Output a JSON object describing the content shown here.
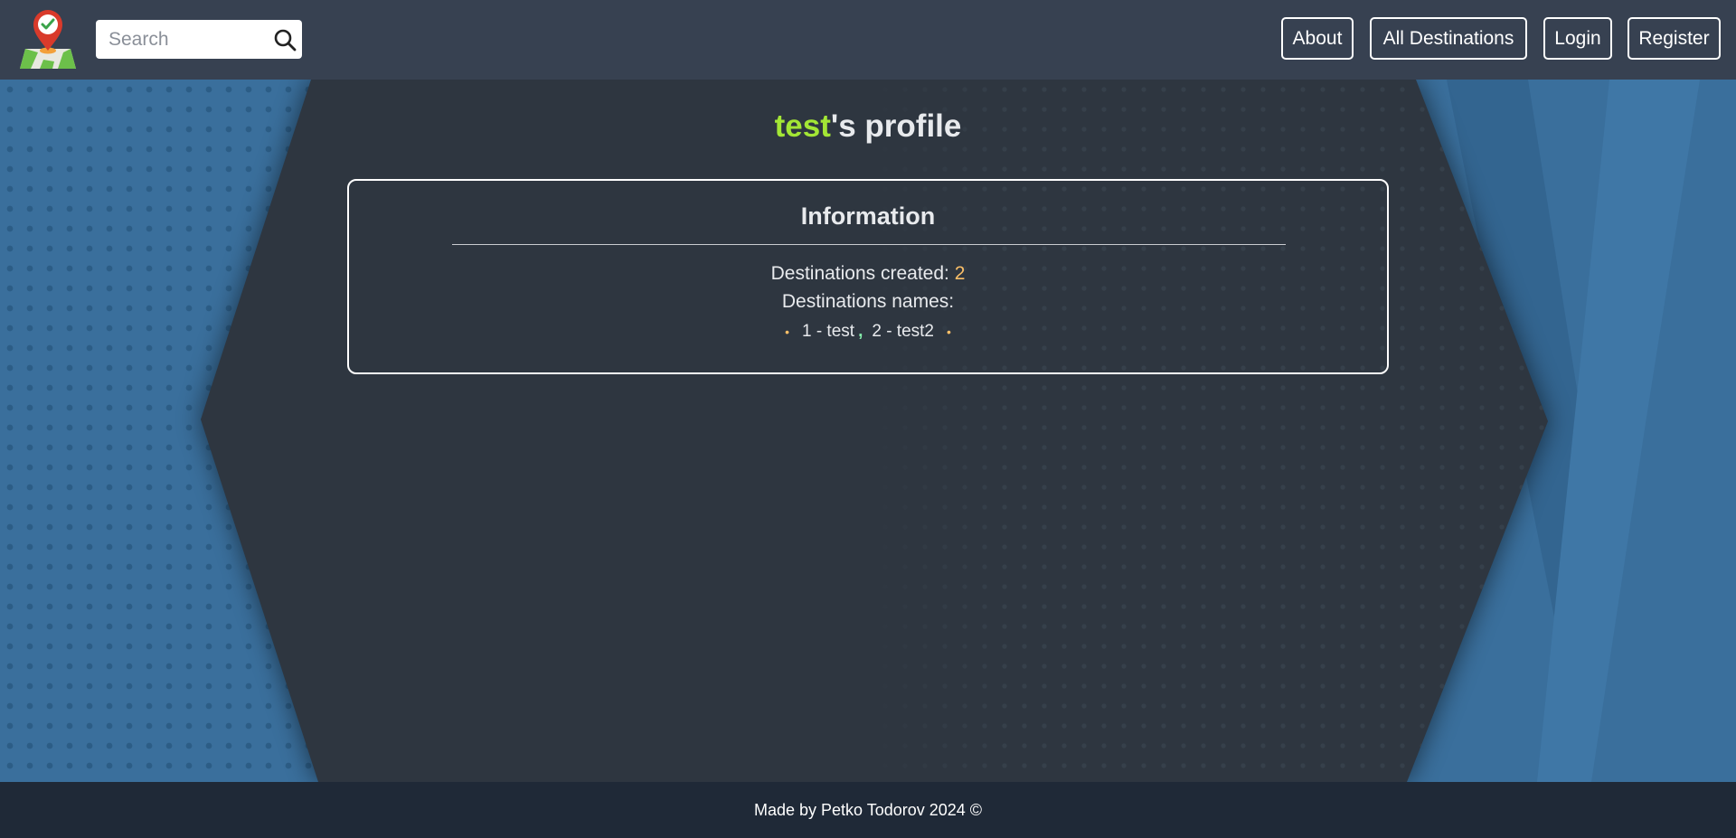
{
  "header": {
    "search": {
      "placeholder": "Search"
    },
    "nav": {
      "about": "About",
      "all_destinations": "All Destinations",
      "login": "Login",
      "register": "Register"
    }
  },
  "profile": {
    "username": "test",
    "title_suffix": "'s profile",
    "info": {
      "heading": "Information",
      "created_label": "Destinations created:",
      "created_count": "2",
      "names_label": "Destinations names:",
      "destinations": [
        {
          "label": "1 - test"
        },
        {
          "label": "2 - test2"
        }
      ],
      "separator": ","
    }
  },
  "footer": {
    "text": "Made by Petko Todorov 2024 ©"
  },
  "colors": {
    "header_bg": "#374151",
    "footer_bg": "#1f2937",
    "page_bg": "#2e3640",
    "side_blue": "#3a6f9c",
    "username_accent": "#a3e635",
    "count_accent": "#fbbf68"
  },
  "icons": {
    "logo": "map-pin-check-icon",
    "search": "search-icon"
  }
}
